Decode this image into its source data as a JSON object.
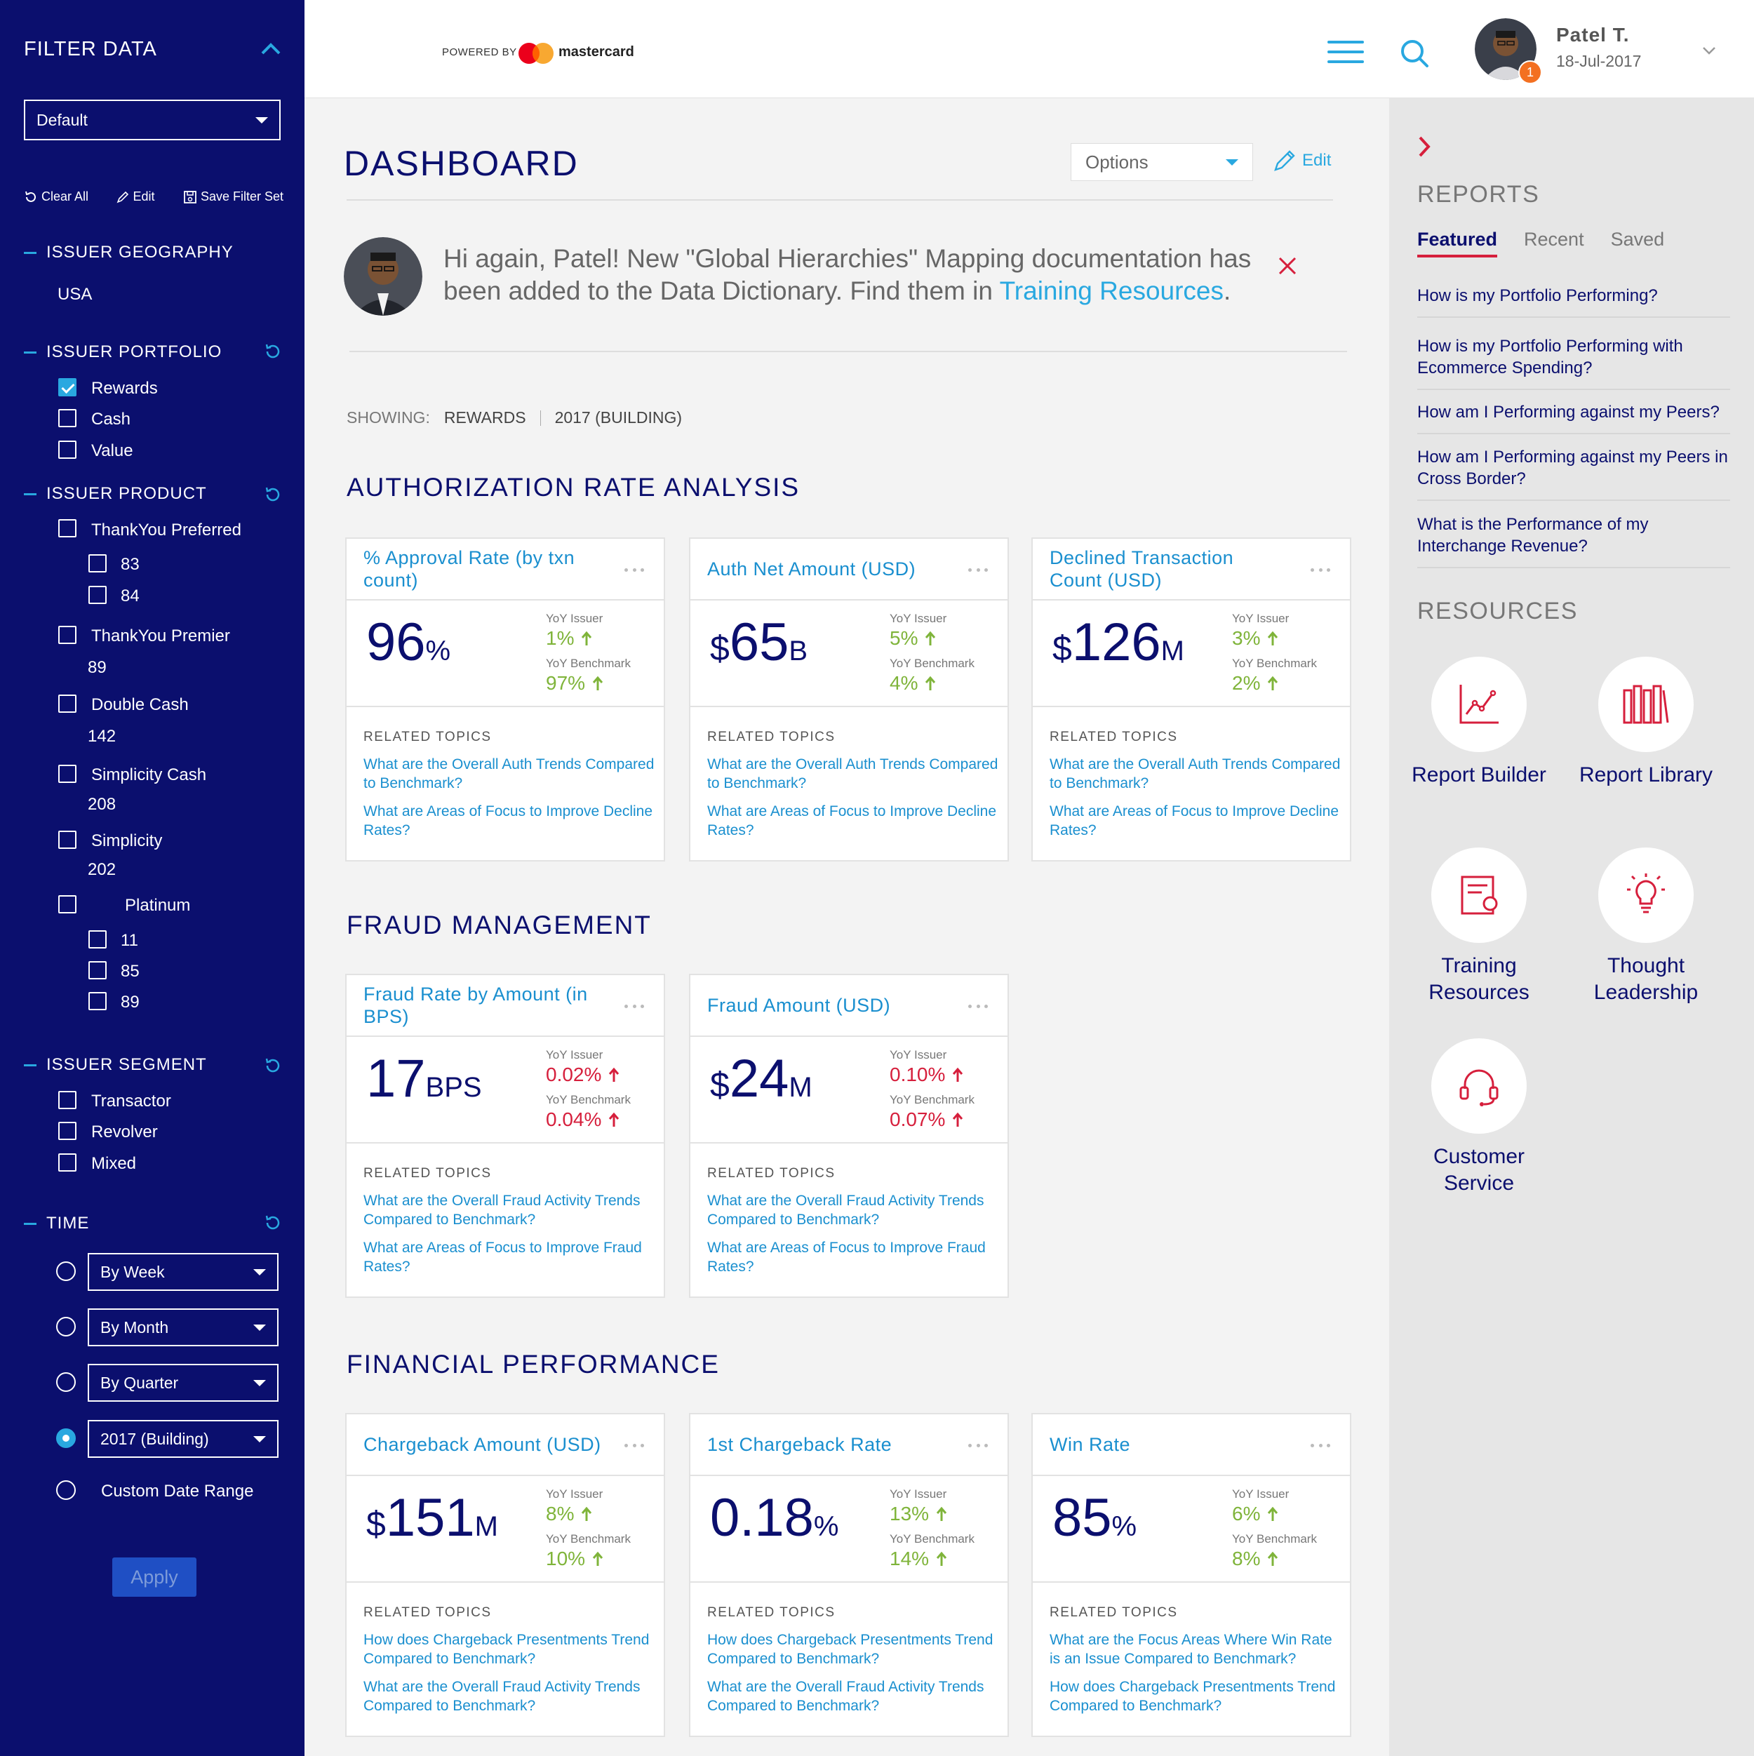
{
  "sidebar": {
    "title": "FILTER DATA",
    "preset": "Default",
    "actions": {
      "clear": "Clear All",
      "edit": "Edit",
      "save": "Save Filter Set"
    },
    "geography": {
      "heading": "ISSUER GEOGRAPHY",
      "value": "USA"
    },
    "portfolio": {
      "heading": "ISSUER PORTFOLIO",
      "items": [
        "Rewards",
        "Cash",
        "Value"
      ],
      "checked": "Rewards"
    },
    "product": {
      "heading": "ISSUER PRODUCT",
      "items": [
        "ThankYou Preferred",
        "83",
        "84",
        "ThankYou Premier",
        "89",
        "Double Cash",
        "142",
        "Simplicity Cash",
        "208",
        "Simplicity",
        "202",
        "Platinum",
        "11",
        "85",
        "89"
      ]
    },
    "segment": {
      "heading": "ISSUER SEGMENT",
      "items": [
        "Transactor",
        "Revolver",
        "Mixed"
      ]
    },
    "time": {
      "heading": "TIME",
      "options": [
        "By Week",
        "By Month",
        "By Quarter",
        "2017 (Building)",
        "Custom Date Range"
      ],
      "selected": "2017 (Building)"
    },
    "apply": "Apply"
  },
  "topbar": {
    "powered": "POWERED BY",
    "brand": "mastercard",
    "user_name": "Patel T.",
    "user_date": "18-Jul-2017",
    "notif_count": "1",
    "colors": {
      "accent": "#29a8e0",
      "brand_red": "#eb001b",
      "brand_orange": "#f79e1b",
      "badge": "#f37021"
    }
  },
  "main": {
    "title": "DASHBOARD",
    "options": "Options",
    "edit": "Edit",
    "message": {
      "text": "Hi again, Patel! New \"Global Hierarchies\" Mapping documentation has been added to the Data Dictionary. Find them in ",
      "link": "Training Resources",
      "end": "."
    },
    "showing": {
      "label": "SHOWING:",
      "a": "REWARDS",
      "b": "2017 (BUILDING)"
    },
    "yoy_issuer_label": "YoY Issuer",
    "yoy_bench_label": "YoY Benchmark",
    "related_label": "RELATED TOPICS",
    "sections": [
      {
        "title": "AUTHORIZATION RATE ANALYSIS",
        "cards": [
          {
            "title": "% Approval Rate (by txn count)",
            "pre": "",
            "value": "96",
            "suf": "%",
            "issuer": "1%",
            "bench": "97%",
            "trend": "up",
            "links": [
              "What are the Overall Auth Trends Compared to Benchmark?",
              "What are Areas of Focus to Improve Decline Rates?"
            ]
          },
          {
            "title": "Auth Net Amount (USD)",
            "pre": "$",
            "value": "65",
            "suf": "B",
            "issuer": "5%",
            "bench": "4%",
            "trend": "up",
            "links": [
              "What are the Overall Auth Trends Compared to Benchmark?",
              "What are Areas of Focus to Improve Decline Rates?"
            ]
          },
          {
            "title": "Declined Transaction Count (USD)",
            "pre": "$",
            "value": "126",
            "suf": "M",
            "issuer": "3%",
            "bench": "2%",
            "trend": "up",
            "links": [
              "What are the Overall Auth Trends Compared to Benchmark?",
              "What are Areas of Focus to Improve Decline Rates?"
            ]
          }
        ]
      },
      {
        "title": "FRAUD MANAGEMENT",
        "cards": [
          {
            "title": "Fraud Rate by Amount (in BPS)",
            "pre": "",
            "value": "17",
            "suf": "BPS",
            "issuer": "0.02%",
            "bench": "0.04%",
            "trend": "up-red",
            "links": [
              "What are the Overall Fraud Activity Trends Compared to Benchmark?",
              "What are Areas of Focus to Improve Fraud Rates?"
            ]
          },
          {
            "title": "Fraud Amount (USD)",
            "pre": "$",
            "value": "24",
            "suf": "M",
            "issuer": "0.10%",
            "bench": "0.07%",
            "trend": "up-red",
            "links": [
              "What are the Overall Fraud Activity Trends Compared to Benchmark?",
              "What are Areas of Focus to Improve Fraud Rates?"
            ]
          }
        ]
      },
      {
        "title": "FINANCIAL PERFORMANCE",
        "cards": [
          {
            "title": "Chargeback Amount (USD)",
            "pre": "$",
            "value": "151",
            "suf": "M",
            "issuer": "8%",
            "bench": "10%",
            "trend": "up",
            "links": [
              "How does Chargeback Presentments Trend Compared to Benchmark?",
              "What are the Overall Fraud Activity Trends Compared to Benchmark?"
            ]
          },
          {
            "title": "1st Chargeback Rate",
            "pre": "",
            "value": "0.18",
            "suf": "%",
            "issuer": "13%",
            "bench": "14%",
            "trend": "up",
            "links": [
              "How does Chargeback Presentments Trend Compared to Benchmark?",
              "What are the Overall Fraud Activity Trends Compared to Benchmark?"
            ]
          },
          {
            "title": "Win Rate",
            "pre": "",
            "value": "85",
            "suf": "%",
            "issuer": "6%",
            "bench": "8%",
            "trend": "up",
            "links": [
              "What are the Focus Areas Where Win Rate is an Issue Compared to Benchmark?",
              "How does Chargeback Presentments Trend Compared to Benchmark?"
            ]
          }
        ]
      }
    ]
  },
  "reports": {
    "title": "REPORTS",
    "tabs": [
      "Featured",
      "Recent",
      "Saved"
    ],
    "links": [
      "How is my Portfolio Performing?",
      "How is my Portfolio Performing with Ecommerce Spending?",
      "How am I Performing against my Peers?",
      "How am I Performing against my Peers in Cross Border?",
      "What is the Performance of my Interchange Revenue?"
    ]
  },
  "resources": {
    "title": "RESOURCES",
    "items": [
      {
        "label": "Report Builder",
        "icon": "line-chart-icon"
      },
      {
        "label": "Report Library",
        "icon": "books-icon"
      },
      {
        "label": "Training Resources",
        "icon": "certificate-icon"
      },
      {
        "label": "Thought Leadership",
        "icon": "lightbulb-icon"
      },
      {
        "label": "Customer Service",
        "icon": "headset-icon"
      }
    ]
  }
}
